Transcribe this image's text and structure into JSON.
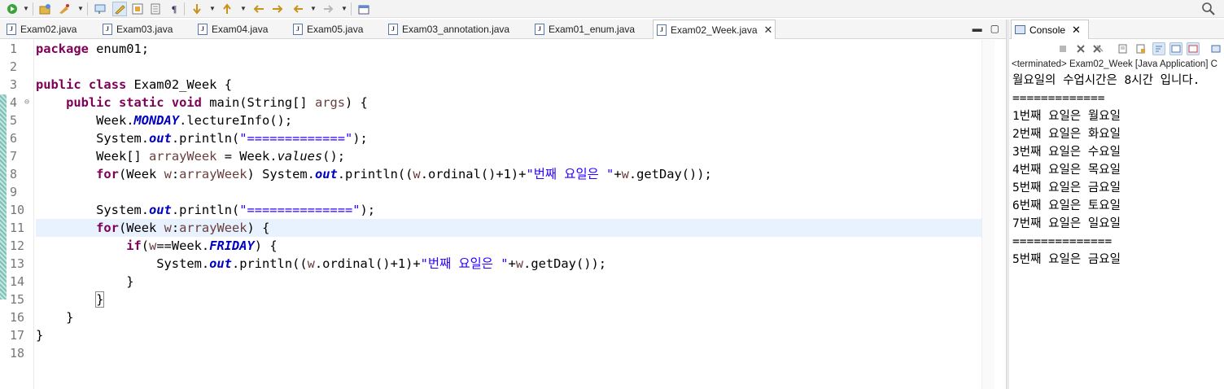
{
  "toolbar": {
    "icons": [
      "run-icon",
      "open-type-icon",
      "debug-icon",
      "toggle-mark-occurrences-icon",
      "toggle-highlight-icon",
      "toggle-block-selection-icon",
      "show-whitespace-icon",
      "next-annotation-icon",
      "previous-annotation-icon",
      "last-edit-icon",
      "back-icon",
      "forward-icon",
      "pin-editor-icon",
      "search-icon"
    ]
  },
  "editor": {
    "tabs": [
      {
        "label": "Exam02.java"
      },
      {
        "label": "Exam03.java"
      },
      {
        "label": "Exam04.java"
      },
      {
        "label": "Exam05.java"
      },
      {
        "label": "Exam03_annotation.java"
      },
      {
        "label": "Exam01_enum.java"
      },
      {
        "label": "Exam02_Week.java",
        "active": true
      }
    ],
    "line_numbers": [
      "1",
      "2",
      "3",
      "4",
      "5",
      "6",
      "7",
      "8",
      "9",
      "10",
      "11",
      "12",
      "13",
      "14",
      "15",
      "16",
      "17",
      "18"
    ],
    "current_line": 11,
    "code": {
      "l1_kw": "package",
      "l1_rest": " enum01;",
      "l3_kw1": "public",
      "l3_kw2": "class",
      "l3_rest": " Exam02_Week {",
      "l4_kw1": "public",
      "l4_kw2": "static",
      "l4_kw3": "void",
      "l4_rest1": " main(String[] ",
      "l4_var": "args",
      "l4_rest2": ") {",
      "l5_pre": "Week.",
      "l5_field": "MONDAY",
      "l5_post": ".lectureInfo();",
      "l6_pre": "System.",
      "l6_field": "out",
      "l6_mid": ".println(",
      "l6_str": "\"=============\"",
      "l6_post": ");",
      "l7_pre": "Week[] ",
      "l7_var": "arrayWeek",
      "l7_mid": " = Week.",
      "l7_it": "values",
      "l7_post": "();",
      "l8_kw": "for",
      "l8_a": "(Week ",
      "l8_v1": "w",
      "l8_b": ":",
      "l8_v2": "arrayWeek",
      "l8_c": ") System.",
      "l8_field": "out",
      "l8_d": ".println((",
      "l8_v3": "w",
      "l8_e": ".ordinal()+1)+",
      "l8_str": "\"번째 요일은 \"",
      "l8_f": "+",
      "l8_v4": "w",
      "l8_g": ".getDay());",
      "l10_pre": "System.",
      "l10_field": "out",
      "l10_mid": ".println(",
      "l10_str": "\"==============\"",
      "l10_post": ");",
      "l11_kw": "for",
      "l11_a": "(Week ",
      "l11_v1": "w",
      "l11_b": ":",
      "l11_v2": "arrayWeek",
      "l11_c": ") {",
      "l12_kw": "if",
      "l12_a": "(",
      "l12_v1": "w",
      "l12_b": "==Week.",
      "l12_field": "FRIDAY",
      "l12_c": ") {",
      "l13_pre": "System.",
      "l13_field": "out",
      "l13_mid": ".println((",
      "l13_v1": "w",
      "l13_b": ".ordinal()+1)+",
      "l13_str": "\"번째 요일은 \"",
      "l13_c": "+",
      "l13_v2": "w",
      "l13_d": ".getDay());",
      "l14": "}",
      "l15": "}",
      "l16": "}",
      "l17": "}"
    }
  },
  "console": {
    "tab_label": "Console",
    "status": "<terminated> Exam02_Week [Java Application] C",
    "output": [
      "월요일의 수업시간은 8시간 입니다.",
      "=============",
      "1번째 요일은 월요일",
      "2번째 요일은 화요일",
      "3번째 요일은 수요일",
      "4번째 요일은 목요일",
      "5번째 요일은 금요일",
      "6번째 요일은 토요일",
      "7번째 요일은 일요일",
      "==============",
      "5번째 요일은 금요일"
    ]
  }
}
